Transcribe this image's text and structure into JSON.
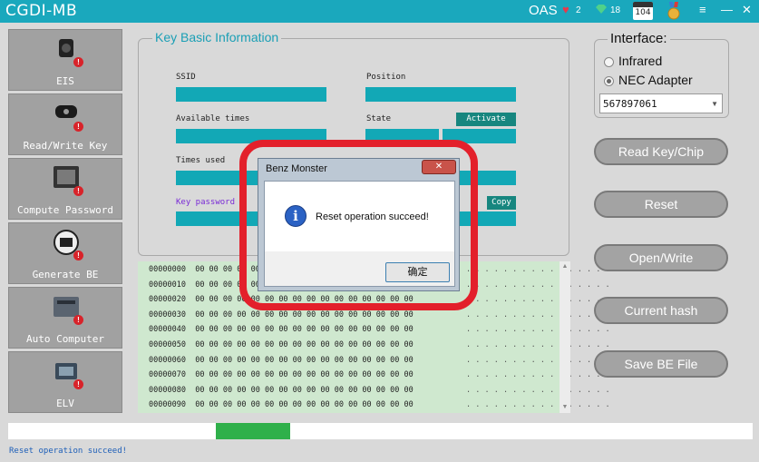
{
  "window": {
    "title": "CGDI-MB",
    "oas": "OAS",
    "heart_count": "2",
    "gem_count": "18",
    "calendar_day": "104",
    "controls": [
      "≡",
      "—",
      "✕"
    ]
  },
  "nav": [
    {
      "label": "EIS"
    },
    {
      "label": "Read/Write Key"
    },
    {
      "label": "Compute Password"
    },
    {
      "label": "Generate BE"
    },
    {
      "label": "Auto Computer"
    },
    {
      "label": "ELV"
    }
  ],
  "key_info": {
    "title": "Key Basic Information",
    "ssid_label": "SSID",
    "position_label": "Position",
    "available_times_label": "Available times",
    "state_label": "State",
    "activate_label": "Activate",
    "times_used_label": "Times used",
    "key_password_label": "Key password",
    "copy_label": "Copy"
  },
  "hex": {
    "addresses": [
      "00000000",
      "00000010",
      "00000020",
      "00000030",
      "00000040",
      "00000050",
      "00000060",
      "00000070",
      "00000080",
      "00000090"
    ],
    "bytes_row": "00 00 00 00 00 00 00 00 00 00 00 00 00 00 00 00",
    "ascii_row": ". . . . . . . . . . . . . . . ."
  },
  "interface": {
    "title": "Interface:",
    "options": [
      {
        "label": "Infrared",
        "selected": false
      },
      {
        "label": "NEC Adapter",
        "selected": true
      }
    ],
    "port_value": "567897061"
  },
  "actions": {
    "read_key": "Read Key/Chip",
    "reset": "Reset",
    "open_write": "Open/Write",
    "current_hash": "Current hash",
    "save_be": "Save BE File"
  },
  "progress": {
    "value": 0.1
  },
  "status": {
    "text": "Reset operation succeed!"
  },
  "dialog": {
    "title": "Benz Monster",
    "close_symbol": "✕",
    "icon_glyph": "i",
    "message": "Reset operation succeed!",
    "ok_label": "确定"
  },
  "colors": {
    "title_bar": "#1aa8bd",
    "field_bar": "#12a8b6",
    "highlight": "#e3202b",
    "progress": "#2fb04a",
    "hex_bg": "#cfe8cf"
  }
}
